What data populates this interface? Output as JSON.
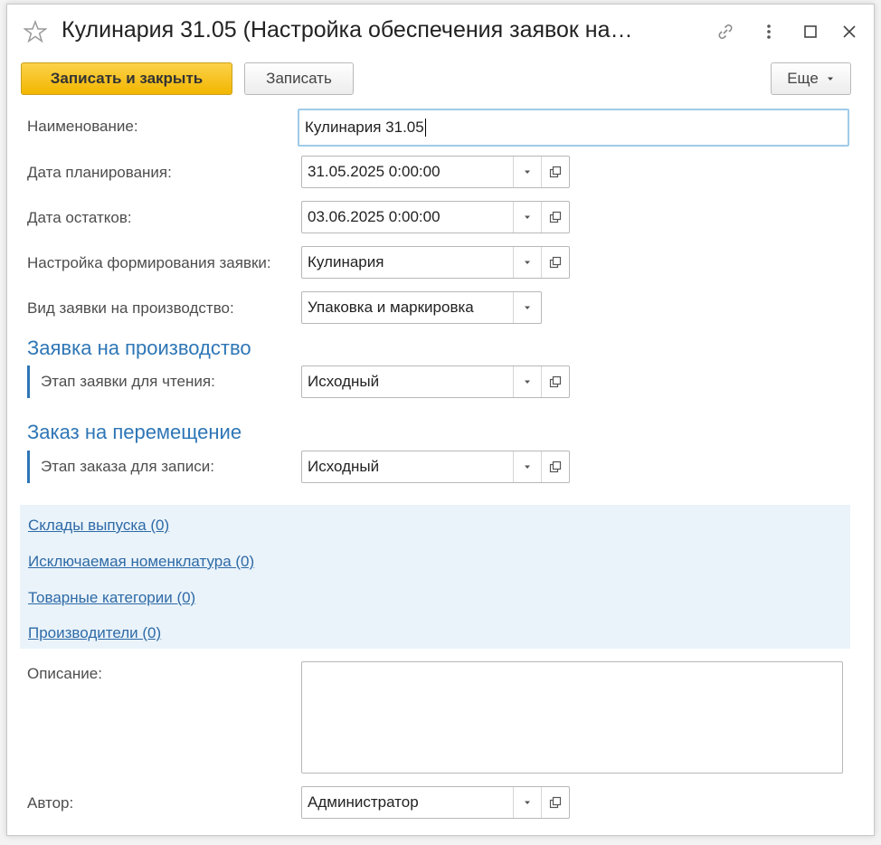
{
  "window": {
    "title": "Кулинария 31.05 (Настройка обеспечения заявок на…",
    "icons": [
      "star-icon",
      "link-icon",
      "more-vertical-icon",
      "maximize-icon",
      "close-icon"
    ]
  },
  "toolbar": {
    "save_close_label": "Записать и закрыть",
    "save_label": "Записать",
    "more_label": "Еще"
  },
  "form": {
    "name": {
      "label": "Наименование:",
      "value": "Кулинария 31.05"
    },
    "plan_date": {
      "label": "Дата планирования:",
      "value": "31.05.2025 0:00:00"
    },
    "stock_date": {
      "label": "Дата остатков:",
      "value": "03.06.2025 0:00:00"
    },
    "request_setting": {
      "label": "Настройка формирования заявки:",
      "value": "Кулинария"
    },
    "request_kind": {
      "label": "Вид заявки на производство:",
      "value": "Упаковка и маркировка"
    }
  },
  "production_request": {
    "title": "Заявка на производство",
    "stage": {
      "label": "Этап заявки для чтения:",
      "value": "Исходный"
    }
  },
  "transfer_order": {
    "title": "Заказ на перемещение",
    "stage": {
      "label": "Этап заказа для записи:",
      "value": "Исходный"
    }
  },
  "links": [
    {
      "label": "Склады выпуска (0)"
    },
    {
      "label": "Исключаемая номенклатура (0)"
    },
    {
      "label": "Товарные категории (0)"
    },
    {
      "label": "Производители (0)"
    }
  ],
  "description": {
    "label": "Описание:",
    "value": ""
  },
  "author": {
    "label": "Автор:",
    "value": "Администратор"
  },
  "colors": {
    "accent": "#f2b600",
    "section": "#2e76b6",
    "link": "#2e6aa6",
    "links_panel_bg": "#eaf3fa"
  }
}
